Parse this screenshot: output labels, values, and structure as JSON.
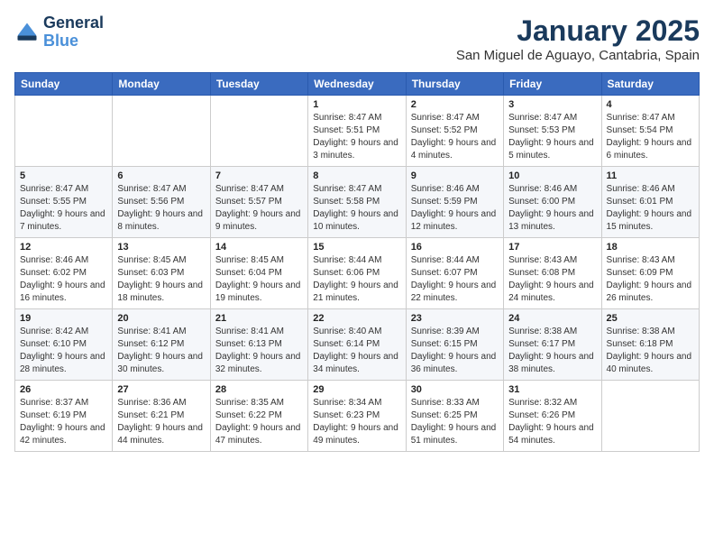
{
  "header": {
    "logo_line1": "General",
    "logo_line2": "Blue",
    "month": "January 2025",
    "location": "San Miguel de Aguayo, Cantabria, Spain"
  },
  "weekdays": [
    "Sunday",
    "Monday",
    "Tuesday",
    "Wednesday",
    "Thursday",
    "Friday",
    "Saturday"
  ],
  "weeks": [
    [
      {
        "day": "",
        "content": ""
      },
      {
        "day": "",
        "content": ""
      },
      {
        "day": "",
        "content": ""
      },
      {
        "day": "1",
        "content": "Sunrise: 8:47 AM\nSunset: 5:51 PM\nDaylight: 9 hours and 3 minutes."
      },
      {
        "day": "2",
        "content": "Sunrise: 8:47 AM\nSunset: 5:52 PM\nDaylight: 9 hours and 4 minutes."
      },
      {
        "day": "3",
        "content": "Sunrise: 8:47 AM\nSunset: 5:53 PM\nDaylight: 9 hours and 5 minutes."
      },
      {
        "day": "4",
        "content": "Sunrise: 8:47 AM\nSunset: 5:54 PM\nDaylight: 9 hours and 6 minutes."
      }
    ],
    [
      {
        "day": "5",
        "content": "Sunrise: 8:47 AM\nSunset: 5:55 PM\nDaylight: 9 hours and 7 minutes."
      },
      {
        "day": "6",
        "content": "Sunrise: 8:47 AM\nSunset: 5:56 PM\nDaylight: 9 hours and 8 minutes."
      },
      {
        "day": "7",
        "content": "Sunrise: 8:47 AM\nSunset: 5:57 PM\nDaylight: 9 hours and 9 minutes."
      },
      {
        "day": "8",
        "content": "Sunrise: 8:47 AM\nSunset: 5:58 PM\nDaylight: 9 hours and 10 minutes."
      },
      {
        "day": "9",
        "content": "Sunrise: 8:46 AM\nSunset: 5:59 PM\nDaylight: 9 hours and 12 minutes."
      },
      {
        "day": "10",
        "content": "Sunrise: 8:46 AM\nSunset: 6:00 PM\nDaylight: 9 hours and 13 minutes."
      },
      {
        "day": "11",
        "content": "Sunrise: 8:46 AM\nSunset: 6:01 PM\nDaylight: 9 hours and 15 minutes."
      }
    ],
    [
      {
        "day": "12",
        "content": "Sunrise: 8:46 AM\nSunset: 6:02 PM\nDaylight: 9 hours and 16 minutes."
      },
      {
        "day": "13",
        "content": "Sunrise: 8:45 AM\nSunset: 6:03 PM\nDaylight: 9 hours and 18 minutes."
      },
      {
        "day": "14",
        "content": "Sunrise: 8:45 AM\nSunset: 6:04 PM\nDaylight: 9 hours and 19 minutes."
      },
      {
        "day": "15",
        "content": "Sunrise: 8:44 AM\nSunset: 6:06 PM\nDaylight: 9 hours and 21 minutes."
      },
      {
        "day": "16",
        "content": "Sunrise: 8:44 AM\nSunset: 6:07 PM\nDaylight: 9 hours and 22 minutes."
      },
      {
        "day": "17",
        "content": "Sunrise: 8:43 AM\nSunset: 6:08 PM\nDaylight: 9 hours and 24 minutes."
      },
      {
        "day": "18",
        "content": "Sunrise: 8:43 AM\nSunset: 6:09 PM\nDaylight: 9 hours and 26 minutes."
      }
    ],
    [
      {
        "day": "19",
        "content": "Sunrise: 8:42 AM\nSunset: 6:10 PM\nDaylight: 9 hours and 28 minutes."
      },
      {
        "day": "20",
        "content": "Sunrise: 8:41 AM\nSunset: 6:12 PM\nDaylight: 9 hours and 30 minutes."
      },
      {
        "day": "21",
        "content": "Sunrise: 8:41 AM\nSunset: 6:13 PM\nDaylight: 9 hours and 32 minutes."
      },
      {
        "day": "22",
        "content": "Sunrise: 8:40 AM\nSunset: 6:14 PM\nDaylight: 9 hours and 34 minutes."
      },
      {
        "day": "23",
        "content": "Sunrise: 8:39 AM\nSunset: 6:15 PM\nDaylight: 9 hours and 36 minutes."
      },
      {
        "day": "24",
        "content": "Sunrise: 8:38 AM\nSunset: 6:17 PM\nDaylight: 9 hours and 38 minutes."
      },
      {
        "day": "25",
        "content": "Sunrise: 8:38 AM\nSunset: 6:18 PM\nDaylight: 9 hours and 40 minutes."
      }
    ],
    [
      {
        "day": "26",
        "content": "Sunrise: 8:37 AM\nSunset: 6:19 PM\nDaylight: 9 hours and 42 minutes."
      },
      {
        "day": "27",
        "content": "Sunrise: 8:36 AM\nSunset: 6:21 PM\nDaylight: 9 hours and 44 minutes."
      },
      {
        "day": "28",
        "content": "Sunrise: 8:35 AM\nSunset: 6:22 PM\nDaylight: 9 hours and 47 minutes."
      },
      {
        "day": "29",
        "content": "Sunrise: 8:34 AM\nSunset: 6:23 PM\nDaylight: 9 hours and 49 minutes."
      },
      {
        "day": "30",
        "content": "Sunrise: 8:33 AM\nSunset: 6:25 PM\nDaylight: 9 hours and 51 minutes."
      },
      {
        "day": "31",
        "content": "Sunrise: 8:32 AM\nSunset: 6:26 PM\nDaylight: 9 hours and 54 minutes."
      },
      {
        "day": "",
        "content": ""
      }
    ]
  ]
}
